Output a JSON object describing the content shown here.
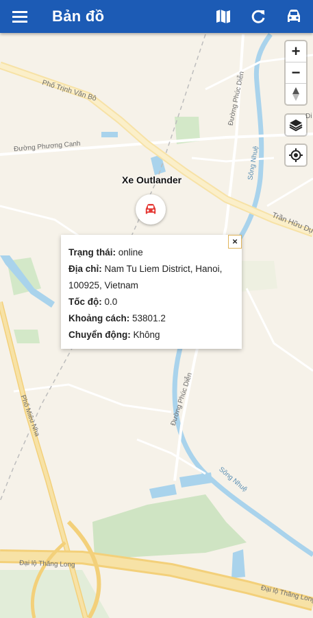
{
  "app": {
    "title": "Bản đồ",
    "icons": [
      "menu-icon",
      "map-icon",
      "refresh-icon",
      "car-icon"
    ]
  },
  "map_controls": {
    "zoom_in": "+",
    "zoom_out": "−",
    "compass": "▲"
  },
  "marker": {
    "label": "Xe Outlander",
    "color": "#e53935"
  },
  "popup": {
    "close": "×",
    "status_label": "Trạng thái:",
    "status_value": "online",
    "address_label": "Địa chỉ:",
    "address_value": "Nam Tu Liem District, Hanoi, 100925, Vietnam",
    "speed_label": "Tốc độ:",
    "speed_value": "0.0",
    "distance_label": "Khoảng cách:",
    "distance_value": "53801.2",
    "motion_label": "Chuyển động:",
    "motion_value": "Không"
  },
  "map_labels": {
    "road1": "Phố Trịnh Văn Bô",
    "road2": "Đường Phương Canh",
    "road3": "Đường Phúc Diễn",
    "road4": "Trần Hữu Dực",
    "road5": "Phố Miêu Nha",
    "road6": "Đường Phúc Diễn",
    "road7": "Đại lộ Thăng Long",
    "road8": "Đại lộ Thăng Long",
    "river1": "Sông Nhuệ",
    "river2": "Sông Nhuệ",
    "poi": "Di"
  },
  "colors": {
    "appbar": "#1c5bb5",
    "map_bg": "#f6f2e9",
    "water": "#a9d3ec",
    "park": "#d3e8c8",
    "major_road": "#f3d07a"
  }
}
